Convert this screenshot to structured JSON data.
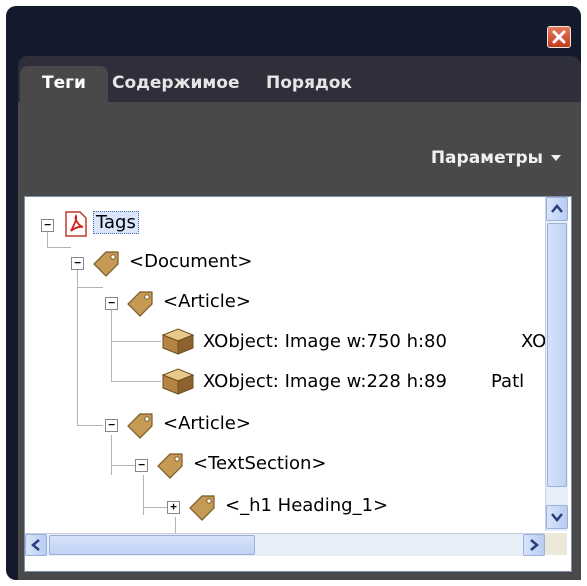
{
  "window": {
    "close_icon": "close-icon"
  },
  "tabs": [
    {
      "label": "Теги",
      "active": true
    },
    {
      "label": "Содержимое",
      "active": false
    },
    {
      "label": "Порядок",
      "active": false
    }
  ],
  "toolbar": {
    "options_label": "Параметры"
  },
  "tree": {
    "nodes": [
      {
        "label": "Tags",
        "icon": "pdf-icon",
        "expanded": true,
        "selected": true
      },
      {
        "label": "<Document>",
        "icon": "tag-icon",
        "expanded": true
      },
      {
        "label": "<Article>",
        "icon": "tag-icon",
        "expanded": true
      },
      {
        "label": "XObject:  Image  w:750 h:80",
        "extra": "XO",
        "icon": "xobject-box-icon"
      },
      {
        "label": "XObject:  Image  w:228 h:89",
        "extra": "Patl",
        "icon": "xobject-box-icon"
      },
      {
        "label": "<Article>",
        "icon": "tag-icon",
        "expanded": true
      },
      {
        "label": "<TextSection>",
        "icon": "tag-icon",
        "expanded": true
      },
      {
        "label": "<_h1 Heading_1>",
        "icon": "tag-icon",
        "expanded": false
      }
    ]
  },
  "colors": {
    "panel_bg": "#121a2c",
    "tab_bg": "#2e2f3b",
    "body_bg": "#4a4848",
    "selection": "#d9e6fb"
  }
}
